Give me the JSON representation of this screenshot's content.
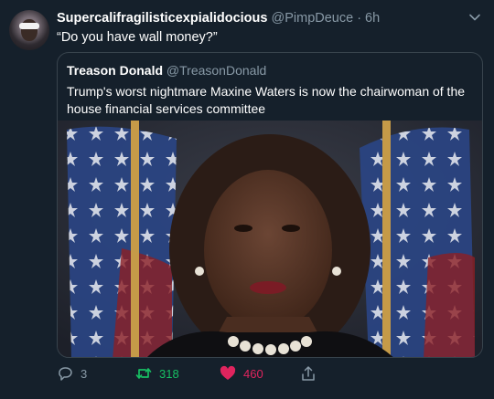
{
  "tweet": {
    "author_name": "Supercalifragilisticexpialidocious",
    "author_handle": "@PimpDeuce",
    "time": "· 6h",
    "text": "“Do you have wall money?”",
    "quote": {
      "author_name": "Treason Donald",
      "author_handle": "@TreasonDonald",
      "text": "Trump's worst nightmare Maxine Waters is now the chairwoman of the house financial services committee"
    },
    "actions": {
      "replies": "3",
      "retweets": "318",
      "likes": "460"
    }
  },
  "colors": {
    "background": "#15202b",
    "border": "#38444d",
    "muted": "#8899a6",
    "retweet": "#17bf63",
    "like": "#e0245e"
  },
  "icons": [
    "chevron-down-icon",
    "reply-icon",
    "retweet-icon",
    "heart-icon",
    "share-icon"
  ]
}
